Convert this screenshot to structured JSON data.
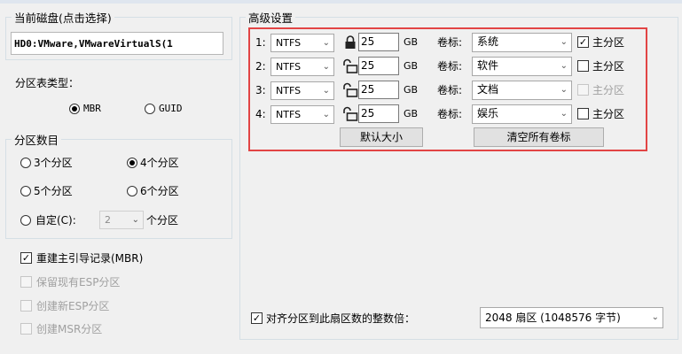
{
  "disk": {
    "group_title": "当前磁盘(点击选择)",
    "selected": "HD0:VMware,VMwareVirtualS(1"
  },
  "partition_table": {
    "label": "分区表类型：",
    "options": [
      "MBR",
      "GUID"
    ],
    "selected": "MBR"
  },
  "partition_count": {
    "group_title": "分区数目",
    "options": [
      "3个分区",
      "4个分区",
      "5个分区",
      "6个分区"
    ],
    "selected": "4个分区",
    "custom_label": "自定(C):",
    "custom_value": "2",
    "custom_suffix": "个分区"
  },
  "options": {
    "rebuild_mbr": "重建主引导记录(MBR)",
    "keep_esp": "保留现有ESP分区",
    "create_esp": "创建新ESP分区",
    "create_msr": "创建MSR分区"
  },
  "advanced": {
    "group_title": "高级设置",
    "unit": "GB",
    "volume_label_caption": "卷标:",
    "primary_caption": "主分区",
    "rows": [
      {
        "index": "1:",
        "fs": "NTFS",
        "size": "25",
        "label": "系统",
        "primary": true,
        "locked": true
      },
      {
        "index": "2:",
        "fs": "NTFS",
        "size": "25",
        "label": "软件",
        "primary": false,
        "locked": false
      },
      {
        "index": "3:",
        "fs": "NTFS",
        "size": "25",
        "label": "文档",
        "primary": false,
        "locked": false
      },
      {
        "index": "4:",
        "fs": "NTFS",
        "size": "25",
        "label": "娱乐",
        "primary": false,
        "locked": false
      }
    ],
    "default_size_button": "默认大小",
    "clear_labels_button": "清空所有卷标"
  },
  "align": {
    "label": "对齐分区到此扇区数的整数倍：",
    "value": "2048 扇区 (1048576 字节)"
  }
}
